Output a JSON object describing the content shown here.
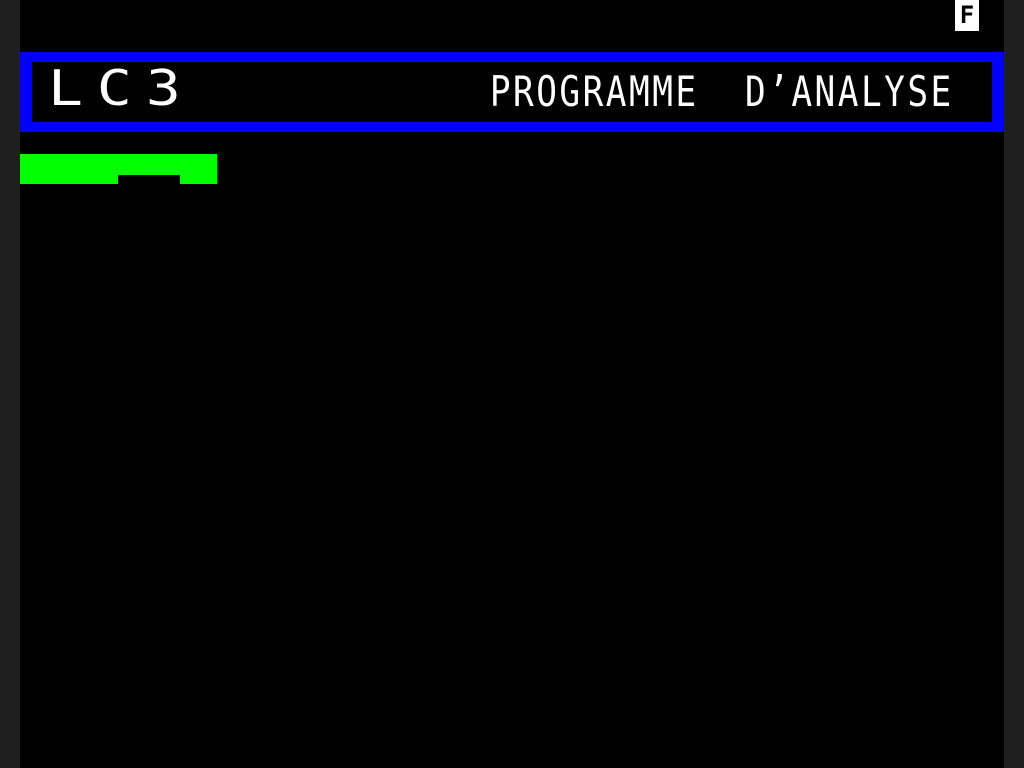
{
  "status": {
    "indicator": "F"
  },
  "header": {
    "app_title": "LC3",
    "subtitle": "PROGRAMME  D’ANALYSE"
  },
  "colors": {
    "screen_background": "#000000",
    "border_background": "#1f1f1f",
    "banner": "#0000ff",
    "text": "#ffffff",
    "cursor_bar": "#00ff00"
  }
}
